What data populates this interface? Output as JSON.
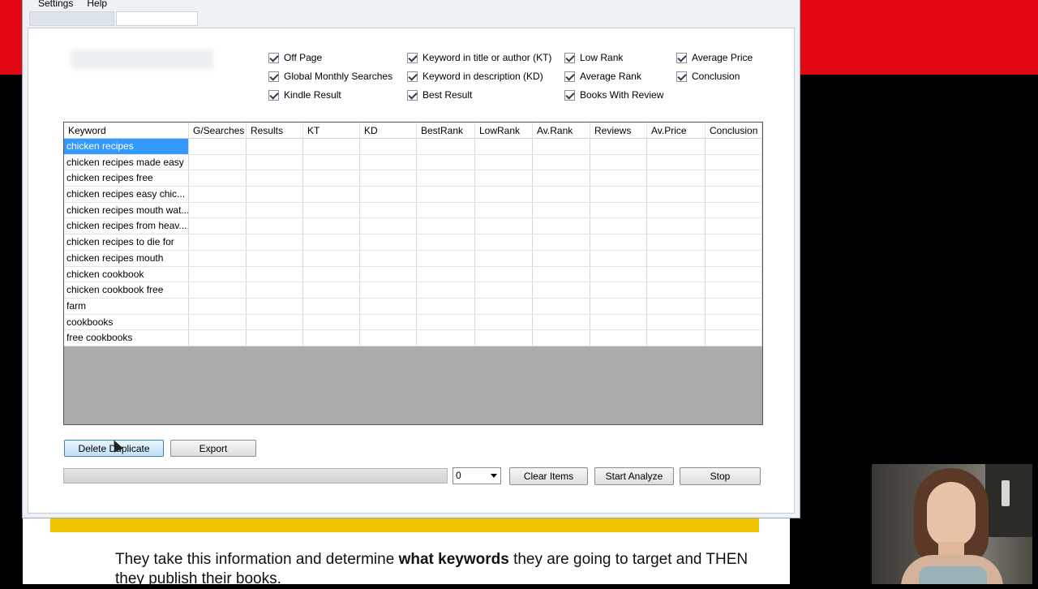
{
  "menu": [
    "Settings",
    "Help"
  ],
  "checkboxes": [
    {
      "label": "Off Page",
      "checked": true
    },
    {
      "label": "Global Monthly Searches",
      "checked": true
    },
    {
      "label": "Kindle Result",
      "checked": true
    },
    {
      "label": "Keyword in title or author (KT)",
      "checked": true
    },
    {
      "label": "Keyword in description (KD)",
      "checked": true
    },
    {
      "label": "Best Result",
      "checked": true
    },
    {
      "label": "Low Rank",
      "checked": true
    },
    {
      "label": "Average Rank",
      "checked": true
    },
    {
      "label": "Books With Review",
      "checked": true
    },
    {
      "label": "Average Price",
      "checked": true
    },
    {
      "label": "Conclusion",
      "checked": true
    }
  ],
  "grid": {
    "columns": [
      "Keyword",
      "G/Searches",
      "Results",
      "KT",
      "KD",
      "BestRank",
      "LowRank",
      "Av.Rank",
      "Reviews",
      "Av.Price",
      "Conclusion"
    ],
    "rows": [
      "chicken recipes",
      "chicken recipes made easy",
      "chicken recipes free",
      "chicken recipes easy chic...",
      "chicken recipes mouth wat...",
      "chicken recipes from heav...",
      "chicken recipes to die for",
      "chicken recipes mouth",
      "chicken cookbook",
      "chicken cookbook free",
      "farm",
      "cookbooks",
      "free cookbooks"
    ],
    "selected_row": 0
  },
  "buttons": {
    "delete_duplicate": "Delete Duplicate",
    "export": "Export",
    "clear_items": "Clear Items",
    "start_analyze": "Start Analyze",
    "stop": "Stop"
  },
  "combo_value": "0",
  "progress": 0,
  "background": {
    "text_pre": "They take this information and determine ",
    "text_bold": "what keywords",
    "text_post": " they are going to target and THEN they publish their books."
  },
  "colors": {
    "selection": "#3399ff",
    "brand_red": "#e30613",
    "banner_yellow": "#f2c400"
  }
}
